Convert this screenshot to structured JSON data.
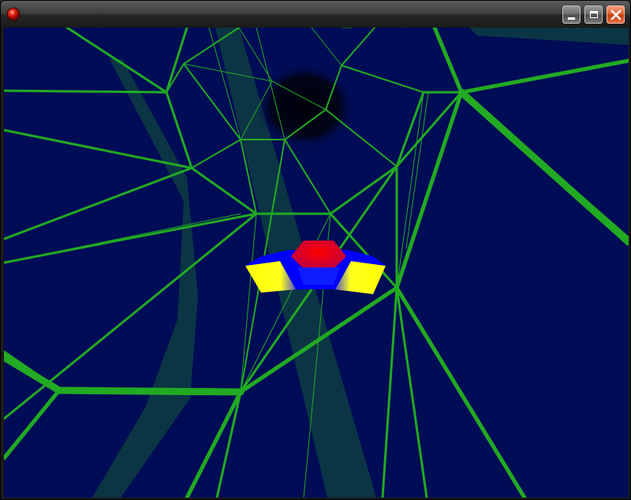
{
  "window": {
    "title": "",
    "controls": {
      "minimize": "minimize",
      "maximize": "maximize",
      "close": "close"
    }
  },
  "icons": {
    "app": "red-orb-icon",
    "minimize": "minimize-icon",
    "maximize": "maximize-icon",
    "close": "close-x-icon"
  },
  "scene": {
    "background_color": "#000c55",
    "wire_color": "#22aa22",
    "beam_color": "#0c3a44",
    "ship_colors": {
      "top": "#ff0000",
      "wings": "#ffff00",
      "body": "#0000ff"
    }
  }
}
